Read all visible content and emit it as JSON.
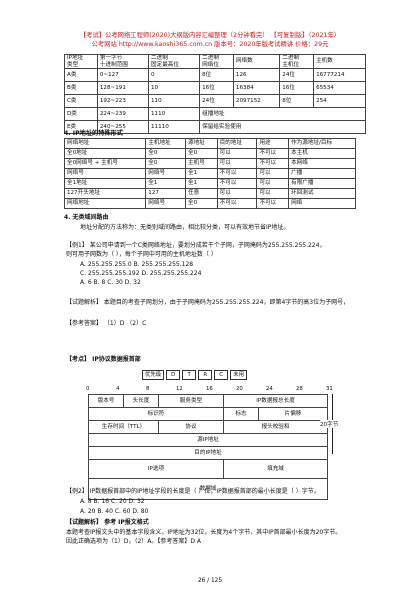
{
  "header": {
    "line1": "【考试】公考网络工程师(2020)大纲版内容汇编整理（2分钟看完）  【可复制版】（2021年）",
    "line2": "公考网站 http://www.kaoshi365.com.cn  版本号：2020年版考试精讲  价格：29元"
  },
  "table1": {
    "headers": [
      "IP地址\n类型",
      "第一字节\n十进制范围",
      "二进制\n固定最高位",
      "二进制\n网络位",
      "网络数",
      "二进制\n主机位",
      "主机数"
    ],
    "rows": [
      [
        "A类",
        "0~127",
        "0",
        "8位",
        "126",
        "24位",
        "16777214"
      ],
      [
        "B类",
        "128~191",
        "10",
        "16位",
        "16384",
        "16位",
        "65534"
      ],
      [
        "C类",
        "192~223",
        "110",
        "24位",
        "2097152",
        "8位",
        "254"
      ],
      [
        "D类",
        "224~239",
        "1110",
        "组播地址",
        "",
        "",
        ""
      ],
      [
        "E类",
        "240~255",
        "11110",
        "保留给实验使用",
        "",
        "",
        ""
      ]
    ]
  },
  "table2": {
    "title": "4. IP地址的特殊形式",
    "headers": [
      "网络地址",
      "主机地址",
      "源地址",
      "目的地址",
      "用途",
      "作为源地址/目标"
    ],
    "rows": [
      [
        "全0地址",
        "全0",
        "全0",
        "可以",
        "不可以",
        "本主机"
      ],
      [
        "全0网络号 + 主机号",
        "全0",
        "主机号",
        "可以",
        "不可以",
        "本网络"
      ],
      [
        "网络号",
        "网络号",
        "全1",
        "不可以",
        "可以",
        "广播"
      ],
      [
        "全1地址",
        "全1",
        "全1",
        "不可以",
        "可以",
        "有限广播"
      ],
      [
        "127开头地址",
        "127",
        "任意",
        "可以",
        "可以",
        "环回测试"
      ],
      [
        "网络地址",
        "网络号",
        "全0",
        "不可以",
        "不可以",
        "网络"
      ]
    ]
  },
  "section": {
    "heading": "4. 无类域间路由",
    "intro": "地址分配的方法称为：无类别域间路由，相比较分类，可以有效地节省IP地址。",
    "ex1_q1": "【例1】 某公司申请到一个C类网络地址，要划分成若干个子网，子网掩码为255.255.255.224，",
    "ex1_q2": "则可用子网数为（ ），每个子网中可用的主机地址数（ ）",
    "ex1_optA": "A. 255.255.255.0          B. 255.255.255.128",
    "ex1_optB": "C. 255.255.255.192        D. 255.255.255.224",
    "ex1_optC": "A. 6     B. 8     C. 30     D. 32",
    "ex1_ans1": "【试题解析】 本题目的考查子网划分，由于子网掩码为255.255.255.224，即第4字节的高3位为子网号，",
    "ex1_ans2": "【参考答案】 （1）D    （2）C"
  },
  "ipsection": {
    "heading": "【考点】 IP协议数据报首部",
    "flags": [
      "优先级",
      "D",
      "T",
      "R",
      "C",
      "未用"
    ],
    "bits": [
      "0",
      "4",
      "8",
      "12",
      "16",
      "20",
      "24",
      "28",
      "31"
    ],
    "rows": [
      [
        "版本号",
        "头长度",
        "服务类型",
        "IP数据报总长度"
      ],
      [
        "标识符",
        "标志",
        "片偏移"
      ],
      [
        "生存时间（TTL）",
        "协议",
        "报头校验和"
      ],
      [
        "源IP地址"
      ],
      [
        "目的IP地址"
      ],
      [
        "IP选项",
        "填充域"
      ],
      [
        "数据域"
      ]
    ],
    "side": "20字节"
  },
  "ex2": {
    "q1": "【例2】 IP数据报首部中的IP地址字段的长度是（ ）位，IP数据报首部的最小长度是（ ）字节。",
    "q2": "A. 8    B. 16    C. 20    D. 32",
    "q3": "A. 20   B. 40    C. 60    D. 80",
    "ans_head": "【试题解析】 参考 IP报文格式",
    "ans1": "本题考查IP报文头中的基本字段含义，IP地址为32位，长度为4个字节，其中IP首部最小长度为20字节。",
    "ans2": "因此正确选项为（1）D，（2）A。【参考答案】D  A"
  },
  "footer": {
    "page": "26 / 125"
  }
}
